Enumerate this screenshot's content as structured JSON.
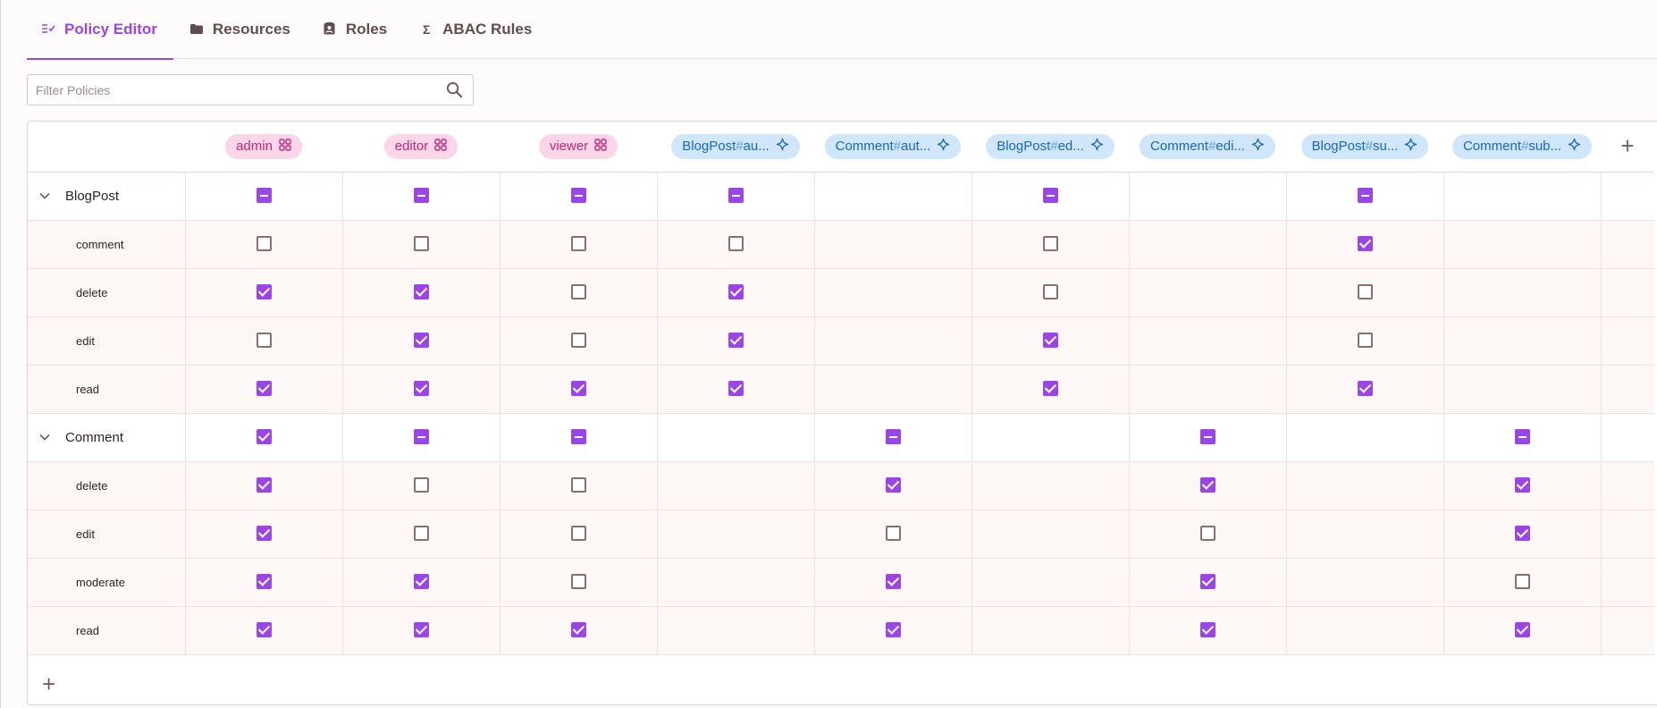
{
  "tabs": [
    {
      "id": "policy-editor",
      "label": "Policy Editor",
      "icon": "policy-icon",
      "active": true
    },
    {
      "id": "resources",
      "label": "Resources",
      "icon": "folder-icon",
      "active": false
    },
    {
      "id": "roles",
      "label": "Roles",
      "icon": "contact-card-icon",
      "active": false
    },
    {
      "id": "abac-rules",
      "label": "ABAC Rules",
      "icon": "sigma-icon",
      "active": false
    }
  ],
  "filter": {
    "placeholder": "Filter Policies",
    "value": ""
  },
  "columns": [
    {
      "label": "admin",
      "kind": "role"
    },
    {
      "label": "editor",
      "kind": "role"
    },
    {
      "label": "viewer",
      "kind": "role"
    },
    {
      "prefix": "BlogPost",
      "suffix": "au...",
      "kind": "abac"
    },
    {
      "prefix": "Comment",
      "suffix": "aut...",
      "kind": "abac"
    },
    {
      "prefix": "BlogPost",
      "suffix": "ed...",
      "kind": "abac"
    },
    {
      "prefix": "Comment",
      "suffix": "edi...",
      "kind": "abac"
    },
    {
      "prefix": "BlogPost",
      "suffix": "su...",
      "kind": "abac"
    },
    {
      "prefix": "Comment",
      "suffix": "sub...",
      "kind": "abac"
    }
  ],
  "colors": {
    "accent": "#9b45e8",
    "role_chip_bg": "#fad6e8",
    "role_chip_fg": "#c0287a",
    "abac_chip_bg": "#cfe6fb",
    "abac_chip_fg": "#1b67b5"
  },
  "resources": [
    {
      "name": "BlogPost",
      "expanded": true,
      "states": [
        "partial",
        "partial",
        "partial",
        "partial",
        "",
        "partial",
        "",
        "partial",
        ""
      ],
      "actions": [
        {
          "name": "comment",
          "states": [
            "unchecked",
            "unchecked",
            "unchecked",
            "unchecked",
            "",
            "unchecked",
            "",
            "checked",
            ""
          ]
        },
        {
          "name": "delete",
          "states": [
            "checked",
            "checked",
            "unchecked",
            "checked",
            "",
            "unchecked",
            "",
            "unchecked",
            ""
          ]
        },
        {
          "name": "edit",
          "states": [
            "unchecked",
            "checked",
            "unchecked",
            "checked",
            "",
            "checked",
            "",
            "unchecked",
            ""
          ]
        },
        {
          "name": "read",
          "states": [
            "checked",
            "checked",
            "checked",
            "checked",
            "",
            "checked",
            "",
            "checked",
            ""
          ]
        }
      ]
    },
    {
      "name": "Comment",
      "expanded": true,
      "states": [
        "checked",
        "partial",
        "partial",
        "",
        "partial",
        "",
        "partial",
        "",
        "partial"
      ],
      "actions": [
        {
          "name": "delete",
          "states": [
            "checked",
            "unchecked",
            "unchecked",
            "",
            "checked",
            "",
            "checked",
            "",
            "checked"
          ]
        },
        {
          "name": "edit",
          "states": [
            "checked",
            "unchecked",
            "unchecked",
            "",
            "unchecked",
            "",
            "unchecked",
            "",
            "checked"
          ]
        },
        {
          "name": "moderate",
          "states": [
            "checked",
            "checked",
            "unchecked",
            "",
            "checked",
            "",
            "checked",
            "",
            "unchecked"
          ]
        },
        {
          "name": "read",
          "states": [
            "checked",
            "checked",
            "checked",
            "",
            "checked",
            "",
            "checked",
            "",
            "checked"
          ]
        }
      ]
    }
  ]
}
